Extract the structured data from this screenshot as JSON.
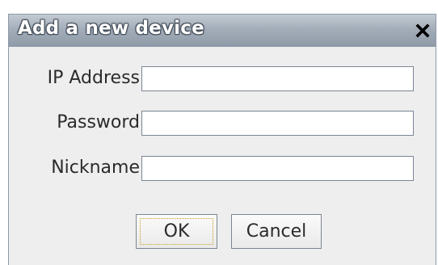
{
  "dialog": {
    "title": "Add a new device",
    "close_icon": "close-icon"
  },
  "form": {
    "fields": [
      {
        "label": "IP Address",
        "value": "",
        "placeholder": ""
      },
      {
        "label": "Password",
        "value": "",
        "placeholder": ""
      },
      {
        "label": "Nickname",
        "value": "",
        "placeholder": ""
      }
    ]
  },
  "buttons": {
    "ok_label": "OK",
    "cancel_label": "Cancel"
  },
  "colors": {
    "titlebar": "#a3adb9",
    "dialog_background": "#eeeeee",
    "focus_ring": "#c9a227"
  }
}
